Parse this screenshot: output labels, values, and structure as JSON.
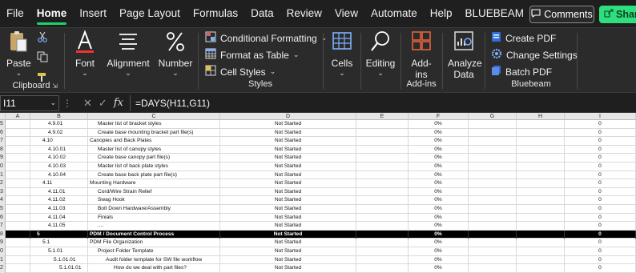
{
  "menu": {
    "items": [
      "File",
      "Home",
      "Insert",
      "Page Layout",
      "Formulas",
      "Data",
      "Review",
      "View",
      "Automate",
      "Help",
      "BLUEBEAM"
    ],
    "active": "Home",
    "comments_label": "Comments",
    "share_label": "Share"
  },
  "ribbon": {
    "paste": "Paste",
    "clipboard": "Clipboard",
    "font": "Font",
    "alignment": "Alignment",
    "number": "Number",
    "conditional_formatting": "Conditional Formatting",
    "format_as_table": "Format as Table",
    "cell_styles": "Cell Styles",
    "styles": "Styles",
    "cells": "Cells",
    "editing": "Editing",
    "add_ins": "Add-ins",
    "add_ins_group": "Add-ins",
    "analyze_data": "Analyze Data",
    "create_pdf": "Create PDF",
    "change_settings": "Change Settings",
    "batch_pdf": "Batch PDF",
    "bluebeam": "Bluebeam",
    "accent": "#1bd26d"
  },
  "formula_bar": {
    "name_box": "I11",
    "fx": "fx",
    "formula": "=DAYS(H11,G11)"
  },
  "grid": {
    "columns": [
      "A",
      "B",
      "C",
      "D",
      "E",
      "F",
      "G",
      "H",
      "I"
    ],
    "row_numbers": [
      "5",
      "6",
      "7",
      "8",
      "9",
      "0",
      "1",
      "2",
      "3",
      "4",
      "5",
      "6",
      "7",
      "8",
      "9",
      "0",
      "1",
      "2"
    ],
    "rows": [
      {
        "b": "4.9.01",
        "c": "Master list of bracket styles",
        "d": "Not Started",
        "f": "0%",
        "i": "0",
        "dark": false,
        "bi": 2,
        "ci": 1
      },
      {
        "b": "4.9.02",
        "c": "Create base mounting bracket part file(s)",
        "d": "Not Started",
        "f": "0%",
        "i": "0",
        "dark": false,
        "bi": 2,
        "ci": 1
      },
      {
        "b": "4.10",
        "c": "Canopies and Back Plates",
        "d": "Not Started",
        "f": "0%",
        "i": "0",
        "dark": false,
        "bi": 1,
        "ci": 0
      },
      {
        "b": "4.10.01",
        "c": "Master list of canopy styles",
        "d": "Not Started",
        "f": "0%",
        "i": "0",
        "dark": false,
        "bi": 2,
        "ci": 1
      },
      {
        "b": "4.10.02",
        "c": "Create base canopy part file(s)",
        "d": "Not Started",
        "f": "0%",
        "i": "0",
        "dark": false,
        "bi": 2,
        "ci": 1
      },
      {
        "b": "4.10.03",
        "c": "Master list of back plate styles",
        "d": "Not Started",
        "f": "0%",
        "i": "0",
        "dark": false,
        "bi": 2,
        "ci": 1
      },
      {
        "b": "4.10.04",
        "c": "Create base back plate part file(s)",
        "d": "Not Started",
        "f": "0%",
        "i": "0",
        "dark": false,
        "bi": 2,
        "ci": 1
      },
      {
        "b": "4.11",
        "c": "Mounting Hardware",
        "d": "Not Started",
        "f": "0%",
        "i": "0",
        "dark": false,
        "bi": 1,
        "ci": 0
      },
      {
        "b": "4.11.01",
        "c": "Cord/Wire Strain Relief",
        "d": "Not Started",
        "f": "0%",
        "i": "0",
        "dark": false,
        "bi": 2,
        "ci": 1
      },
      {
        "b": "4.11.02",
        "c": "Swag Hook",
        "d": "Not Started",
        "f": "0%",
        "i": "0",
        "dark": false,
        "bi": 2,
        "ci": 1
      },
      {
        "b": "4.11.03",
        "c": "Bolt Down Hardware/Assembly",
        "d": "Not Started",
        "f": "0%",
        "i": "0",
        "dark": false,
        "bi": 2,
        "ci": 1
      },
      {
        "b": "4.11.04",
        "c": "Finials",
        "d": "Not Started",
        "f": "0%",
        "i": "0",
        "dark": false,
        "bi": 2,
        "ci": 1
      },
      {
        "b": "4.11.05",
        "c": "....",
        "d": "Not Started",
        "f": "0%",
        "i": "0",
        "dark": false,
        "bi": 2,
        "ci": 1
      },
      {
        "b": "5",
        "c": "PDM / Document Control Process",
        "d": "Not Started",
        "f": "0%",
        "i": "0",
        "dark": true,
        "bi": 0,
        "ci": 0
      },
      {
        "b": "5.1",
        "c": "PDM File Organization",
        "d": "Not Started",
        "f": "0%",
        "i": "0",
        "dark": false,
        "bi": 1,
        "ci": 0
      },
      {
        "b": "5.1.01",
        "c": "Project Folder Template",
        "d": "Not Started",
        "f": "0%",
        "i": "0",
        "dark": false,
        "bi": 2,
        "ci": 1
      },
      {
        "b": "5.1.01.01",
        "c": "Audit folder template for SW file workflow",
        "d": "Not Started",
        "f": "0%",
        "i": "0",
        "dark": false,
        "bi": 3,
        "ci": 2
      },
      {
        "b": "5.1.01.01",
        "c": "How do we deal with part files?",
        "d": "Not Started",
        "f": "0%",
        "i": "0",
        "dark": false,
        "bi": 4,
        "ci": 3
      }
    ]
  }
}
